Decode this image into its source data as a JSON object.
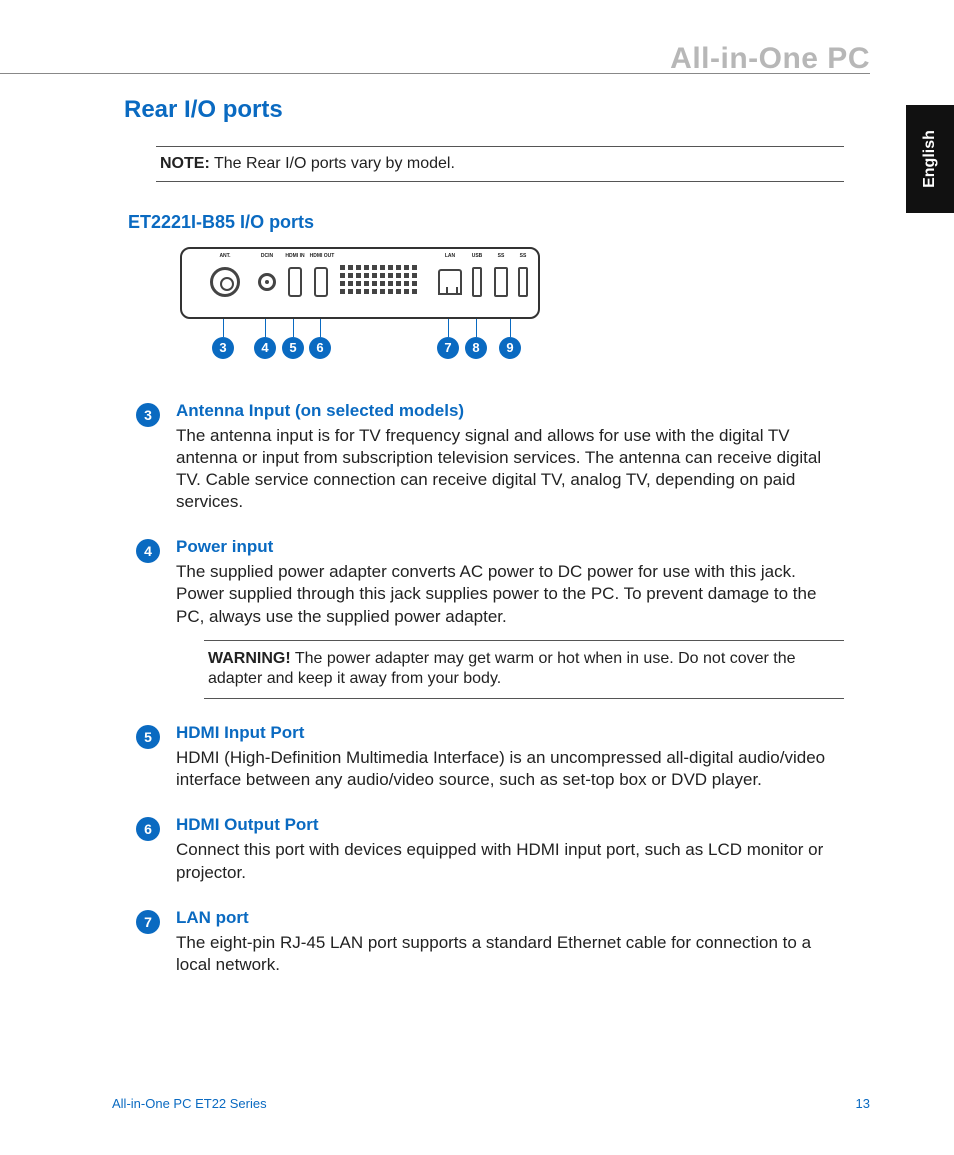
{
  "brand": "All-in-One PC",
  "language_tab": "English",
  "page_title": "Rear I/O ports",
  "note": {
    "label": "NOTE:",
    "text": " The Rear I/O ports vary by model."
  },
  "sub_title": "ET2221I-B85 I/O ports",
  "port_labels": {
    "ant": "ANT.",
    "dc": "DCIN",
    "hdmi_in": "HDMI IN",
    "hdmi_out": "HDMI OUT",
    "lan": "LAN",
    "usb2": "USB",
    "ss1": "SS",
    "ss2": "SS"
  },
  "diagram_callouts": [
    "3",
    "4",
    "5",
    "6",
    "7",
    "8",
    "9"
  ],
  "items": [
    {
      "num": "3",
      "title": "Antenna Input (on selected models)",
      "text": "The antenna input is for TV frequency signal and allows for use with the digital TV antenna or input from subscription television services. The antenna can receive digital TV. Cable service connection can receive digital TV, analog TV, depending on paid services."
    },
    {
      "num": "4",
      "title": "Power input",
      "text": "The supplied power adapter converts AC power to DC power for use with this jack. Power supplied through this jack supplies power to the PC. To prevent damage to the PC, always use the supplied power adapter.",
      "warning": {
        "label": "WARNING!",
        "text": "  The power adapter may get warm or hot when in use. Do not cover the adapter and keep it away from your body."
      }
    },
    {
      "num": "5",
      "title": "HDMI Input Port",
      "text": "HDMI (High-Definition Multimedia Interface) is an uncompressed all-digital audio/video interface between any audio/video source, such as set-top box or DVD player."
    },
    {
      "num": "6",
      "title": "HDMI Output Port",
      "text": "Connect this port with devices equipped with HDMI input port, such as LCD monitor or projector."
    },
    {
      "num": "7",
      "title": "LAN port",
      "text": "The eight-pin RJ-45 LAN port supports a standard Ethernet cable for connection to a local network."
    }
  ],
  "footer": {
    "left": "All-in-One PC ET22 Series",
    "right": "13"
  }
}
